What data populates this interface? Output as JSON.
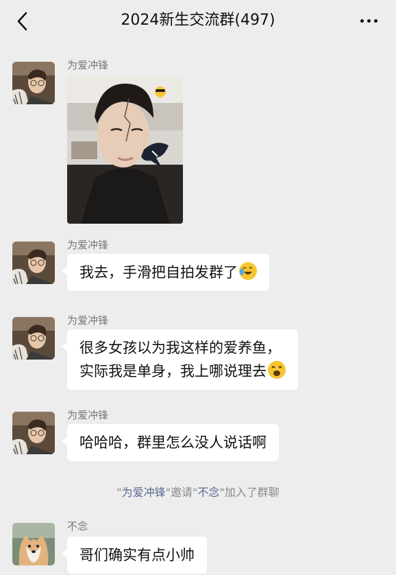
{
  "header": {
    "title": "2024新生交流群(497)",
    "back_icon": "chevron-left-icon",
    "more_icon": "more-dots-icon"
  },
  "messages": [
    {
      "sender": "为爱冲锋",
      "type": "image"
    },
    {
      "sender": "为爱冲锋",
      "type": "text",
      "lines": [
        "我去，手滑把自拍发群了"
      ],
      "emoji": "laughing-crying-emoji"
    },
    {
      "sender": "为爱冲锋",
      "type": "text",
      "lines": [
        "很多女孩以为我这样的爱养鱼，",
        "实际我是单身，我上哪说理去"
      ],
      "emoji": "weary-face-emoji"
    },
    {
      "sender": "为爱冲锋",
      "type": "text",
      "lines": [
        "哈哈哈，群里怎么没人说话啊"
      ]
    },
    {
      "sender": "不念",
      "type": "text",
      "lines": [
        "哥们确实有点小帅"
      ]
    }
  ],
  "system_message": {
    "q1": "\"",
    "inviter": "为爱冲锋",
    "mid1": "\"邀请\"",
    "invitee": "不念",
    "tail": "\"加入了群聊"
  },
  "colors": {
    "background": "#ededed",
    "bubble": "#ffffff",
    "system_name": "#5b6a93"
  }
}
